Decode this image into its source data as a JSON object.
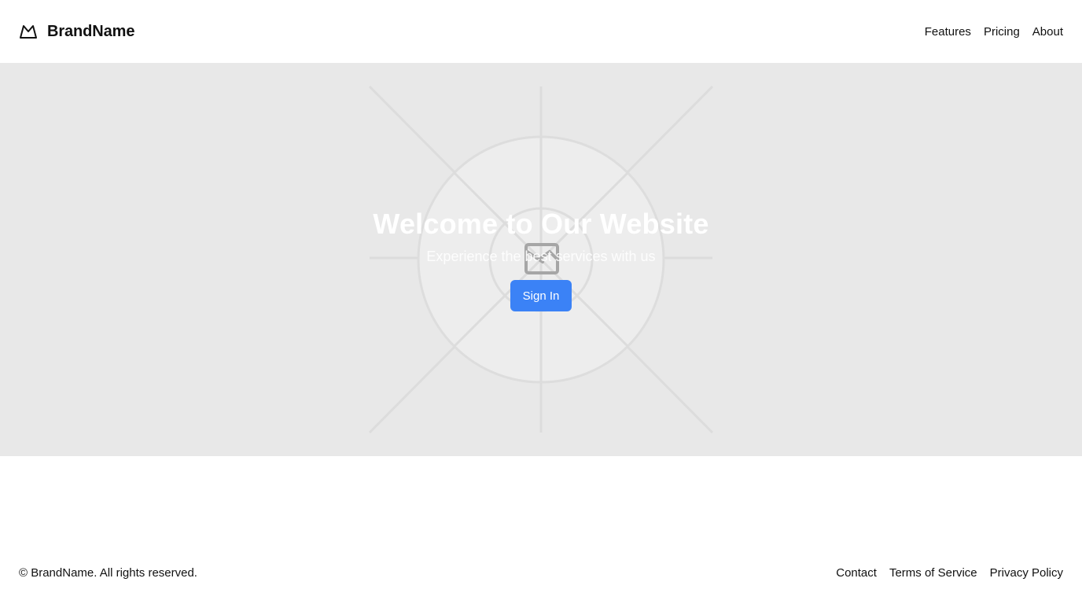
{
  "header": {
    "brand_name": "BrandName",
    "logo_icon": "mountain-icon",
    "nav": [
      {
        "label": "Features"
      },
      {
        "label": "Pricing"
      },
      {
        "label": "About"
      }
    ]
  },
  "hero": {
    "title": "Welcome to Our Website",
    "subtitle": "Experience the best services with us",
    "cta_label": "Sign In",
    "background_icon": "image-placeholder-icon",
    "background_color": "#e8e8e8",
    "cta_color": "#3b82f6"
  },
  "footer": {
    "copyright": "© BrandName. All rights reserved.",
    "links": [
      {
        "label": "Contact"
      },
      {
        "label": "Terms of Service"
      },
      {
        "label": "Privacy Policy"
      }
    ]
  }
}
